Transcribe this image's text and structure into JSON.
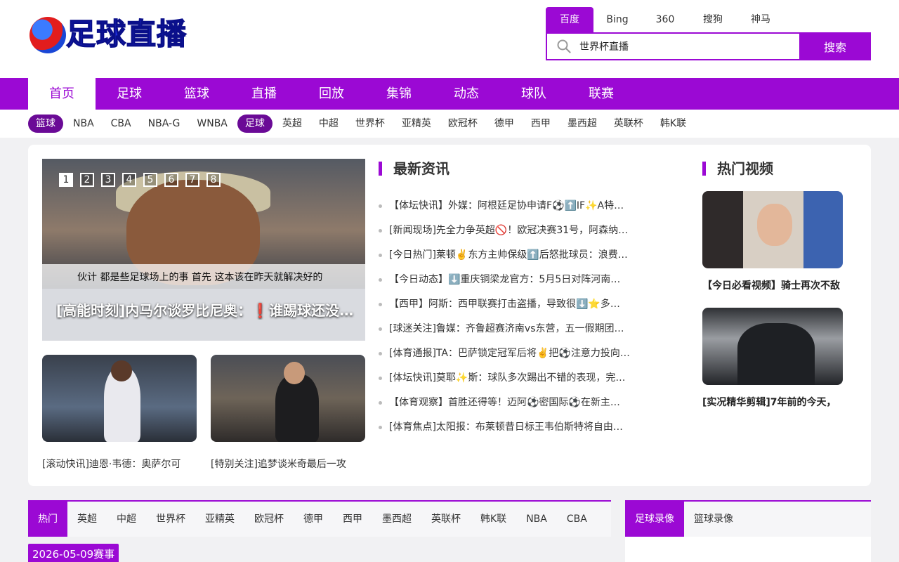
{
  "logo": {
    "text": "足球直播"
  },
  "search": {
    "engines": [
      "百度",
      "Bing",
      "360",
      "搜狗",
      "神马"
    ],
    "active_engine": "百度",
    "value": "世界杯直播",
    "button": "搜索"
  },
  "mainnav": [
    "首页",
    "足球",
    "篮球",
    "直播",
    "回放",
    "集锦",
    "动态",
    "球队",
    "联赛"
  ],
  "subnav": [
    "篮球",
    "NBA",
    "CBA",
    "NBA-G",
    "WNBA",
    "足球",
    "英超",
    "中超",
    "世界杯",
    "亚精英",
    "欧冠杯",
    "德甲",
    "西甲",
    "墨西超",
    "英联杯",
    "韩K联"
  ],
  "slider": {
    "dots": [
      "1",
      "2",
      "3",
      "4",
      "5",
      "6",
      "7",
      "8"
    ],
    "subtitle": "伙计 都是些足球场上的事 首先 这本该在昨天就解决好的",
    "title": "[高能时刻]内马尔谈罗比尼奥：❗谁踢球还没打过…"
  },
  "thumbs": [
    {
      "caption": "[滚动快讯]迪恩·韦德：奥萨尔可"
    },
    {
      "caption": "[特别关注]追梦谈米奇最后一攻"
    }
  ],
  "news": {
    "title": "最新资讯",
    "items": [
      "【体坛快讯】外媒：阿根廷足协申请F⚽⬆️IF✨A特…",
      "[新闻现场]先全力争英超🚫！欧冠决赛31号，阿森纳…",
      "[今日热门]莱顿✌️东方主帅保级⬆️后怒批球员：浪费…",
      "【今日动态】⬇️重庆铜梁龙官方：5月5日对阵河南…",
      "【西甲】阿斯：西甲联赛打击盗播，导致很⬇️⭐多…",
      "[球迷关注]鲁媒：齐鲁超赛济南vs东营，五一假期团…",
      "[体育通报]TA：巴萨锁定冠军后将✌️把⚽注意力投向…",
      "[体坛快讯]莫耶✨斯：球队多次踢出不错的表现，完…",
      "【体育观察】首胜还得等！迈阿⚽密国际⚽在新主…",
      "[体育焦点]太阳报：布莱顿昔日标王韦伯斯特将自由…"
    ]
  },
  "videos": {
    "title": "热门视频",
    "items": [
      {
        "caption": "【今日必看视频】骑士再次不敌"
      },
      {
        "caption": "[实况精华剪辑]7年前的今天，"
      }
    ]
  },
  "bottom_tabs": [
    "热门",
    "英超",
    "中超",
    "世界杯",
    "亚精英",
    "欧冠杯",
    "德甲",
    "西甲",
    "墨西超",
    "英联杯",
    "韩K联",
    "NBA",
    "CBA"
  ],
  "replay_tabs": [
    "足球录像",
    "篮球录像"
  ],
  "date_badge": "2026-05-09赛事",
  "colors": {
    "accent": "#9b09d4",
    "pill": "#6a0a96"
  }
}
